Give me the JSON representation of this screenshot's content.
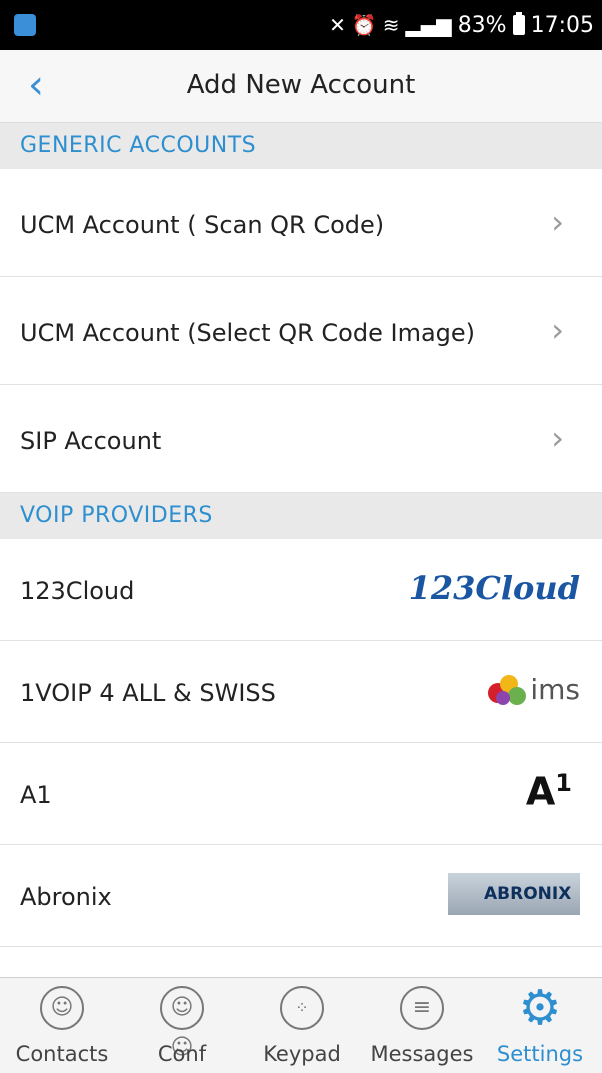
{
  "status_bar": {
    "battery": "83%",
    "time": "17:05"
  },
  "header": {
    "title": "Add New Account",
    "back_icon": "chevron-left-icon"
  },
  "sections": {
    "generic": "GENERIC ACCOUNTS",
    "voip": "VOIP PROVIDERS"
  },
  "generic_accounts": [
    {
      "label": "UCM Account ( Scan QR Code)"
    },
    {
      "label": "UCM Account (Select QR Code Image)"
    },
    {
      "label": "SIP Account"
    }
  ],
  "providers": [
    {
      "label": "123Cloud",
      "logo_text": "123Cloud"
    },
    {
      "label": "1VOIP 4 ALL & SWISS",
      "logo_text": "ims"
    },
    {
      "label": "A1",
      "logo_text": "A",
      "logo_sup": "1"
    },
    {
      "label": "Abronix",
      "logo_text": "ABRONIX"
    }
  ],
  "tabs": [
    {
      "label": "Contacts",
      "icon": "contacts-icon"
    },
    {
      "label": "Conf",
      "icon": "conference-icon"
    },
    {
      "label": "Keypad",
      "icon": "keypad-icon"
    },
    {
      "label": "Messages",
      "icon": "messages-icon"
    },
    {
      "label": "Settings",
      "icon": "gear-icon",
      "active": true
    }
  ],
  "colors": {
    "accent": "#2d8fd0",
    "section_bg": "#e9e9e9"
  }
}
